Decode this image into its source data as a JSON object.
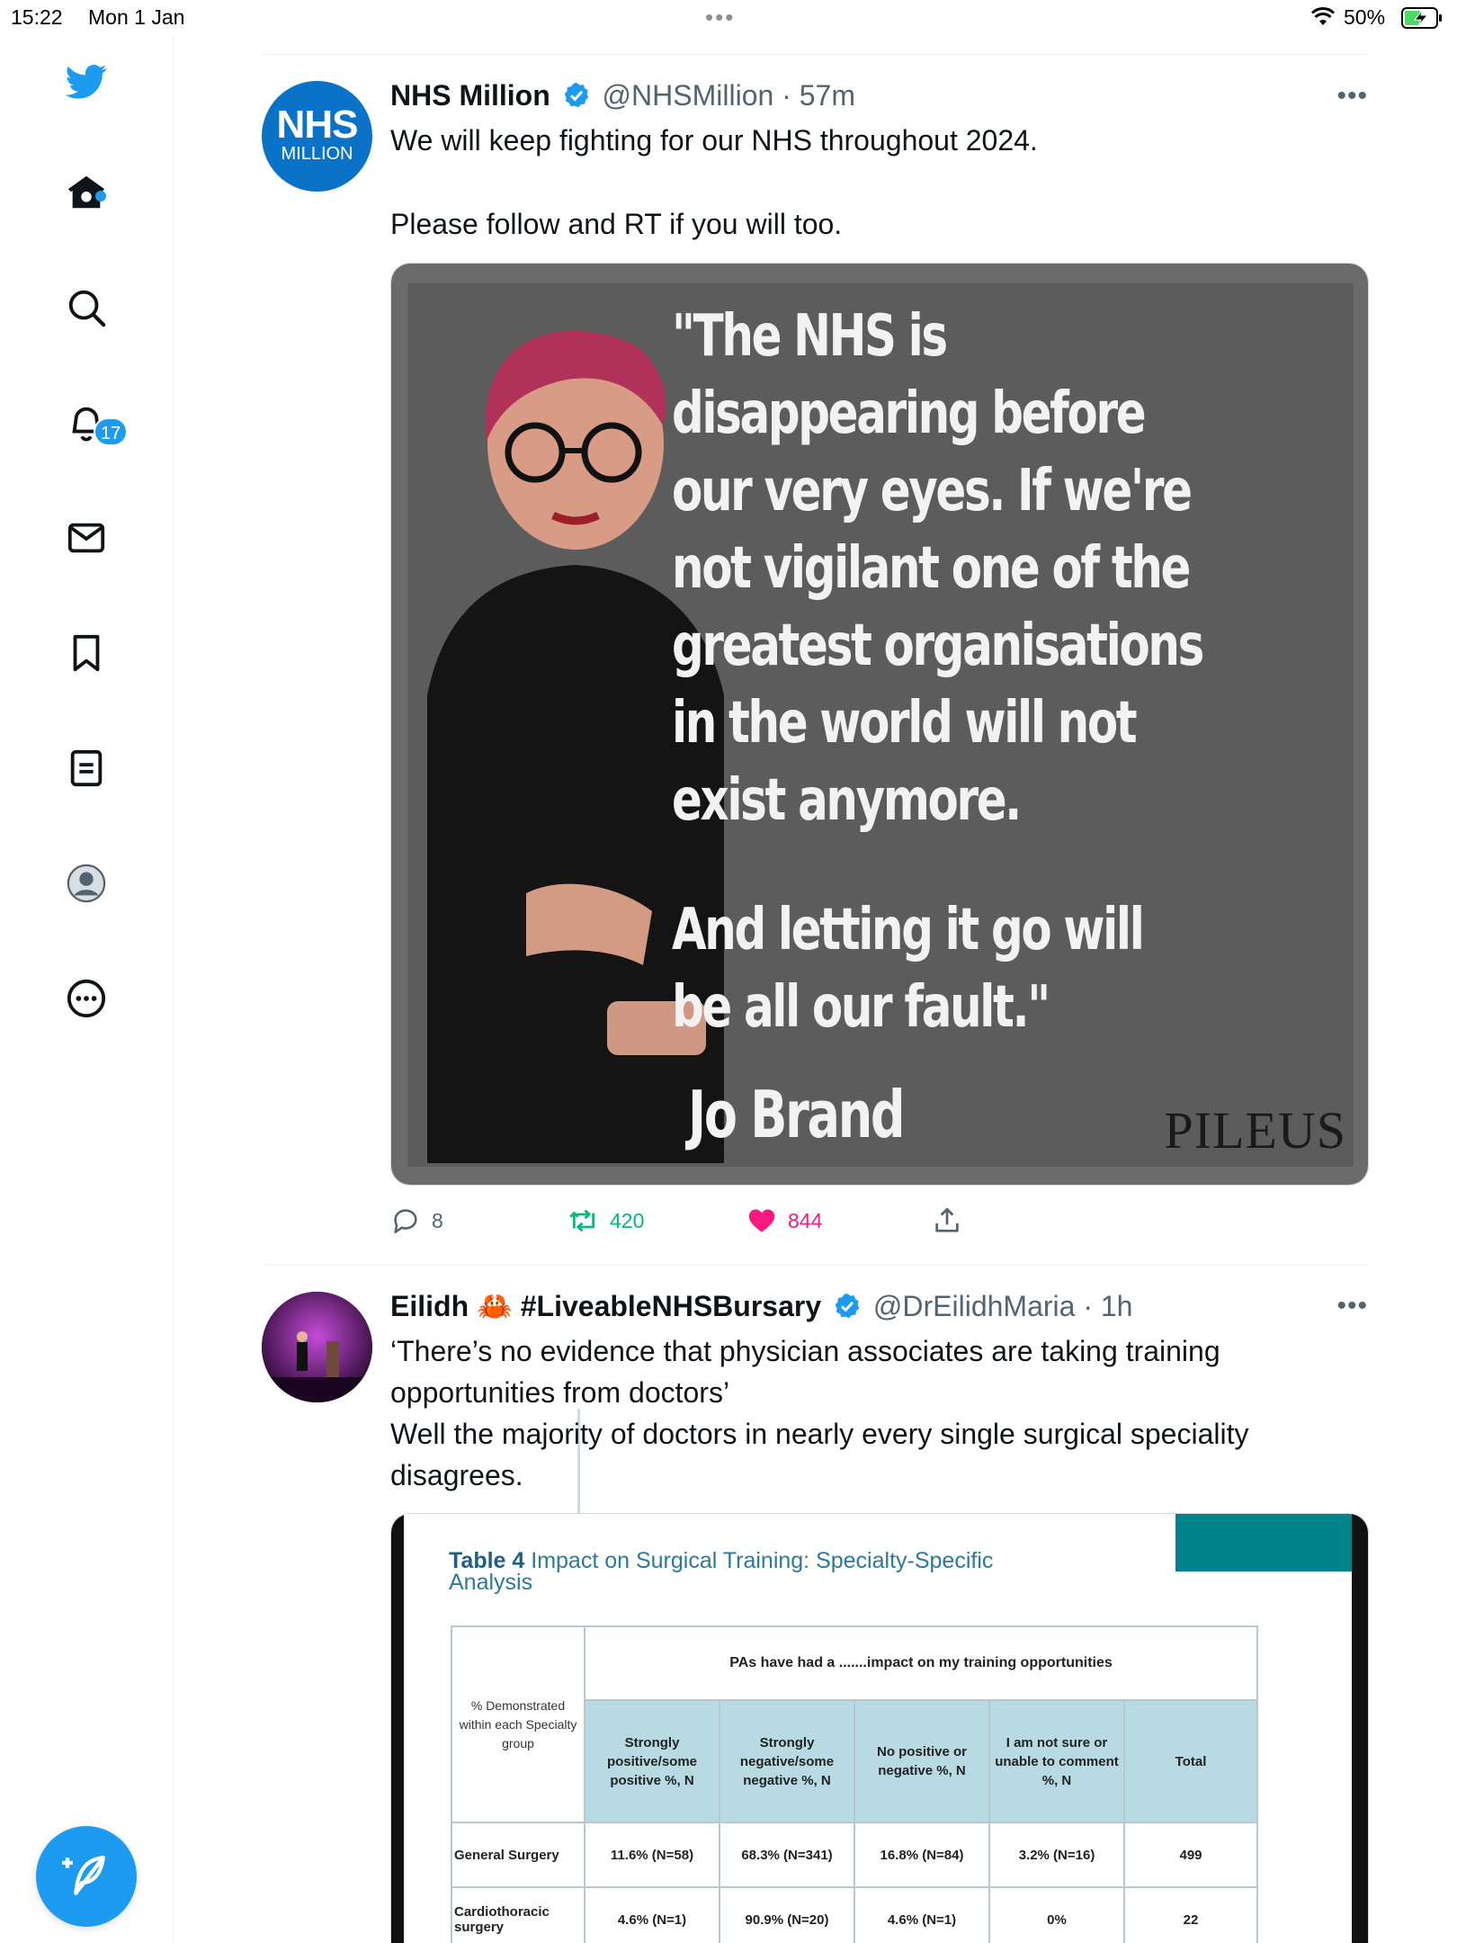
{
  "status_bar": {
    "time": "15:22",
    "date": "Mon 1 Jan",
    "battery": "50%"
  },
  "nav": {
    "notifications_count": "17"
  },
  "colors": {
    "accent": "#1d9bf0",
    "retweet": "#00ba7c",
    "like": "#f91880"
  },
  "tweets": [
    {
      "name": "NHS Million",
      "handle": "@NHSMillion",
      "time": "· 57m",
      "avatar_text_top": "NHS",
      "avatar_text_bottom": "MILLION",
      "text_line1": "We will keep fighting for our NHS throughout 2024.",
      "text_line2": "Please follow and RT if you will too.",
      "media": {
        "quote_lines": [
          "\"The NHS is",
          "disappearing before",
          "our very eyes. If we're",
          "not vigilant one of the",
          "greatest organisations",
          "in the world will not",
          "exist anymore."
        ],
        "quote_lines_2": [
          "And letting it go will",
          "be all our fault.\""
        ],
        "author": "Jo Brand",
        "watermark": "PILEUS"
      },
      "replies": "8",
      "retweets": "420",
      "likes": "844"
    },
    {
      "name": "Eilidh",
      "crab": "🦀",
      "hashtag": "#LiveableNHSBursary",
      "handle": "@DrEilidhMaria",
      "time": "· 1h",
      "text_lines": [
        "‘There’s no evidence that physician associates are taking training",
        "opportunities from doctors’",
        "Well the majority of doctors in nearly every single surgical speciality",
        "disagrees."
      ],
      "table": {
        "title_bold": "Table 4",
        "title_rest": "Impact on Surgical Training: Specialty-Specific",
        "title_line2": "Analysis",
        "group_header": "PAs have had a .......impact on my training opportunities",
        "corner": "% Demonstrated within each Specialty group",
        "columns": [
          "Strongly positive/some positive %, N",
          "Strongly negative/some negative %, N",
          "No positive or negative %, N",
          "I am not sure or unable to comment %, N",
          "Total"
        ],
        "rows": [
          {
            "label": "General Surgery",
            "cells": [
              "11.6% (N=58)",
              "68.3% (N=341)",
              "16.8% (N=84)",
              "3.2% (N=16)",
              "499"
            ]
          },
          {
            "label": "Cardiothoracic surgery",
            "cells": [
              "4.6% (N=1)",
              "90.9% (N=20)",
              "4.6% (N=1)",
              "0%",
              "22"
            ]
          }
        ]
      }
    }
  ]
}
